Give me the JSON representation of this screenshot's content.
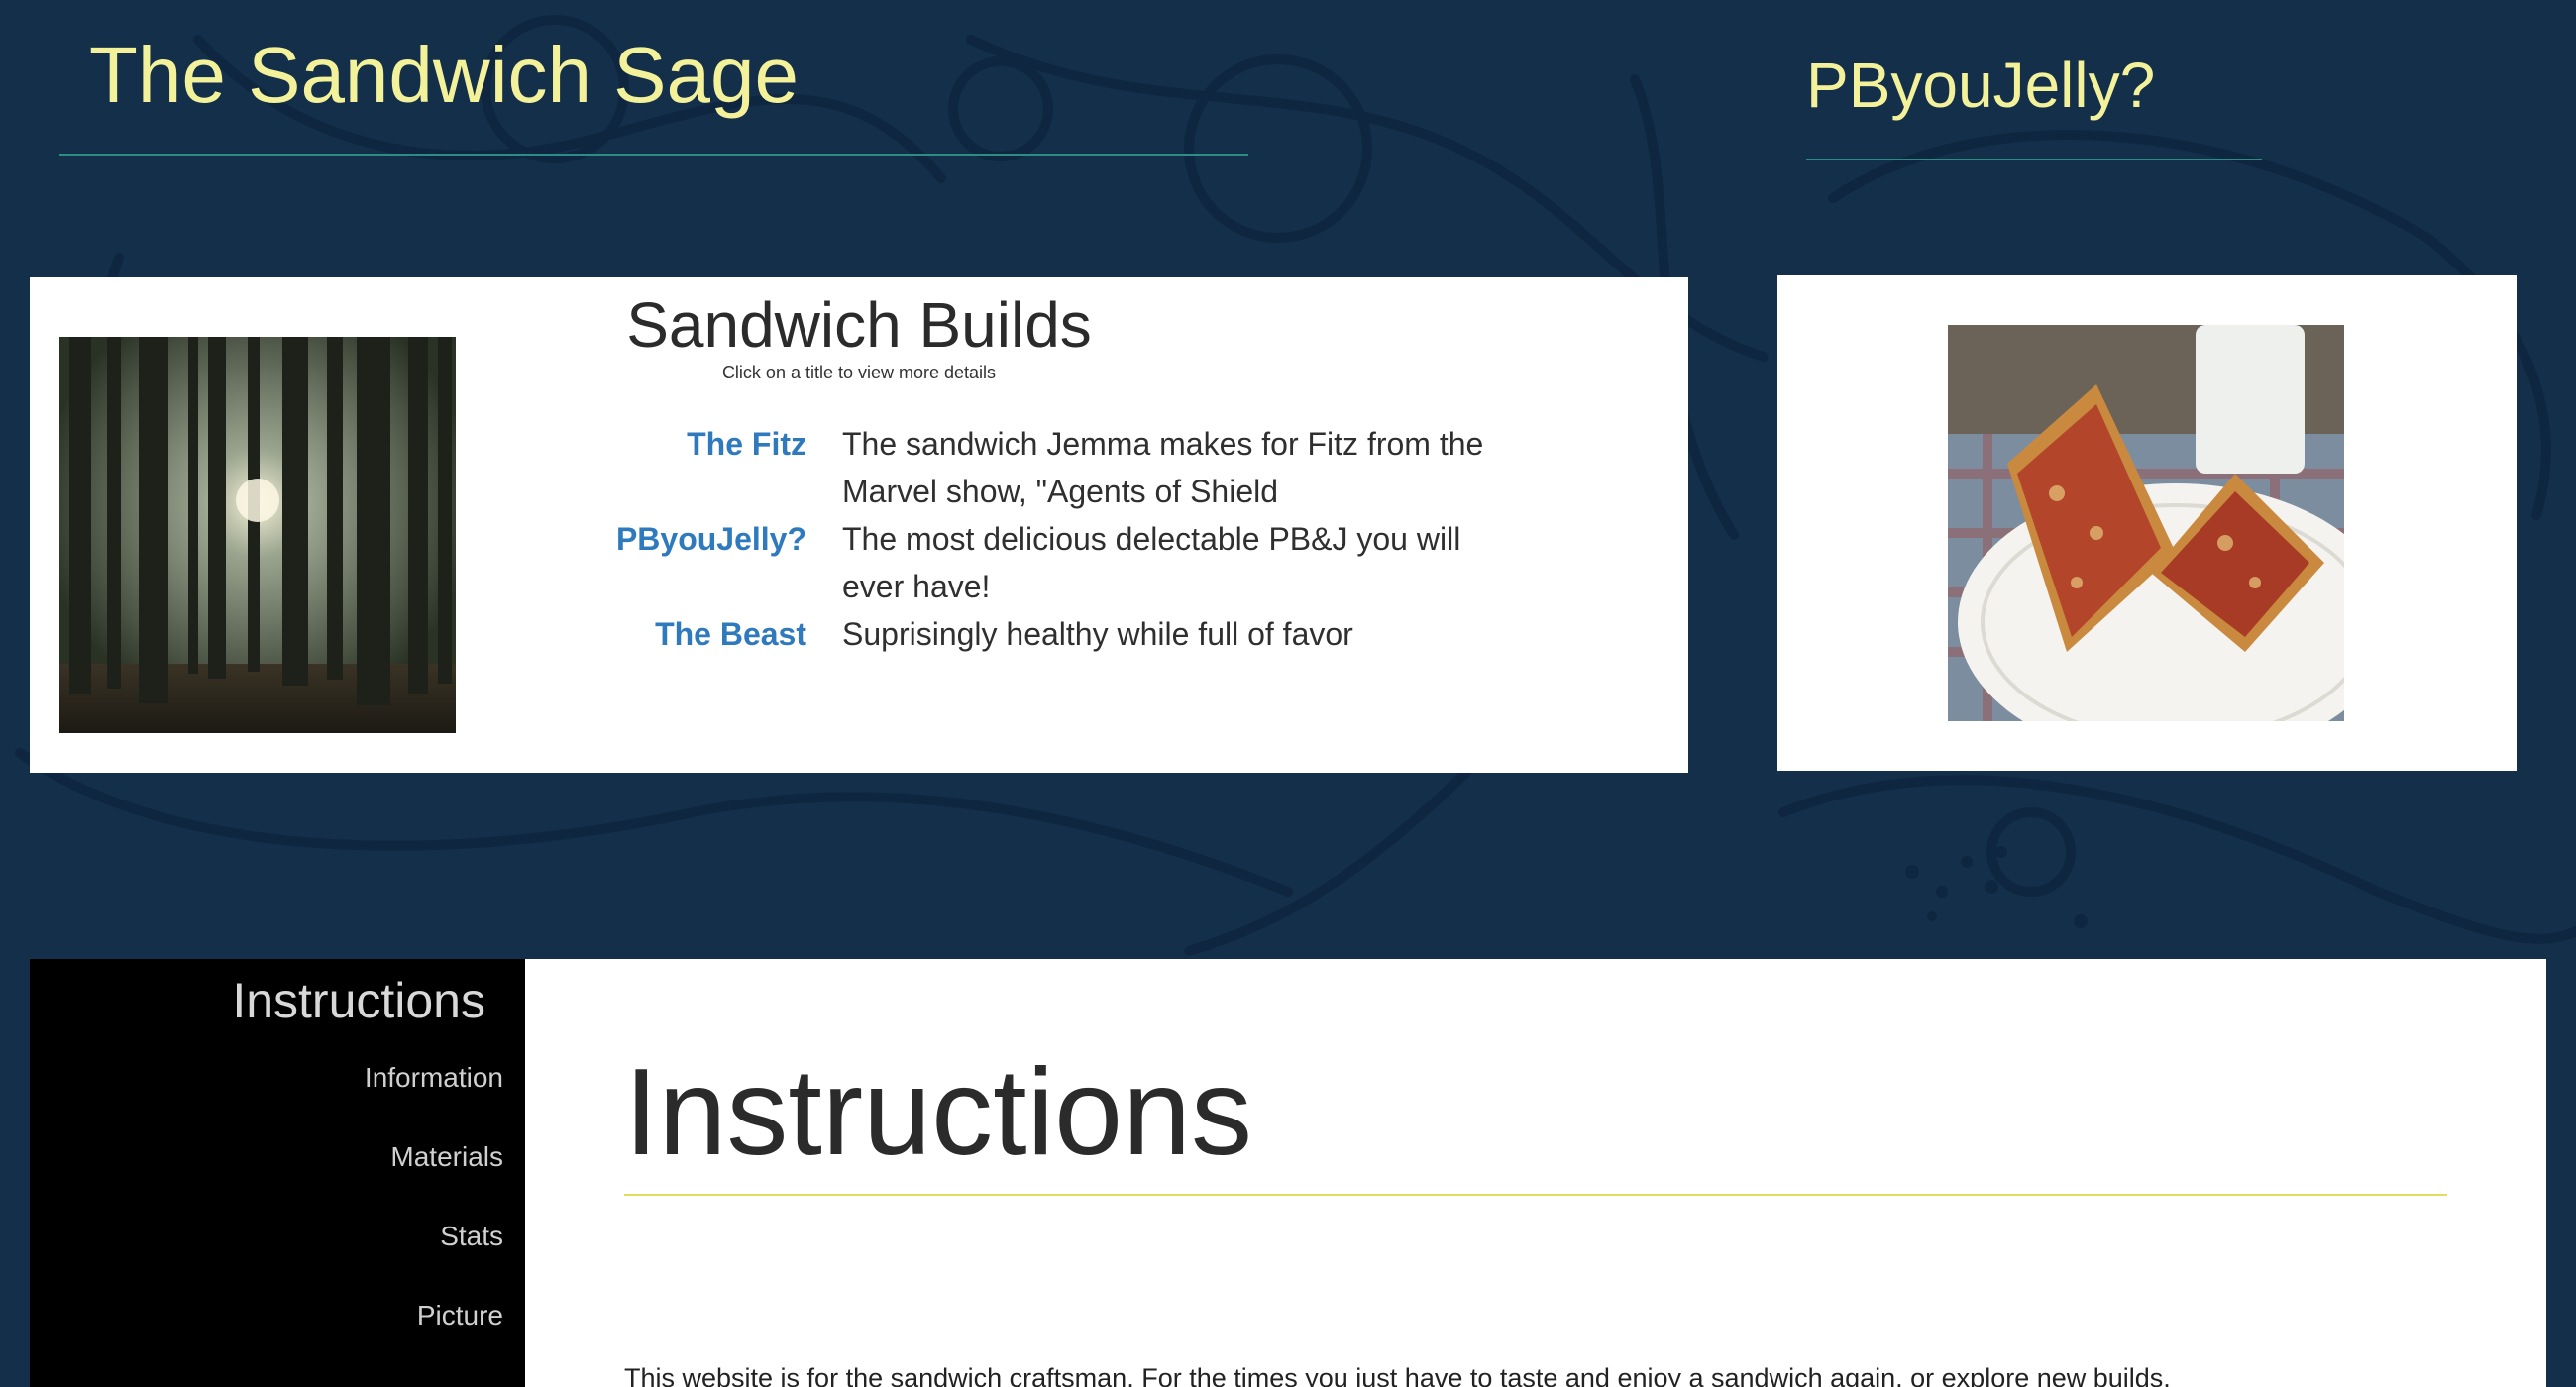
{
  "header": {
    "site_title": "The Sandwich Sage",
    "side_title": "PByouJelly?"
  },
  "builds": {
    "title": "Sandwich Builds",
    "hint": "Click on a title to view more details",
    "items": [
      {
        "name": "The Fitz",
        "description": "The sandwich Jemma makes for Fitz from the Marvel show, \"Agents of Shield"
      },
      {
        "name": "PByouJelly?",
        "description": "The most delicious delectable PB&J you will ever have!"
      },
      {
        "name": "The Beast",
        "description": "Suprisingly healthy while full of favor"
      }
    ]
  },
  "images": {
    "forest": "forest-photo",
    "sandwich": "grilled-sandwich-photo"
  },
  "sidebar": {
    "heading": "Instructions",
    "items": [
      "Information",
      "Materials",
      "Stats",
      "Picture"
    ]
  },
  "content": {
    "title": "Instructions",
    "intro": "This website is for the sandwich craftsman. For the times you just have to taste and enjoy a sandwich again, or explore new builds."
  },
  "colors": {
    "background": "#142f4a",
    "title_yellow": "#f3f29a",
    "link_blue": "#2f79bd",
    "rule_teal": "#2d8c84",
    "rule_yellow": "#e2dd5a"
  }
}
